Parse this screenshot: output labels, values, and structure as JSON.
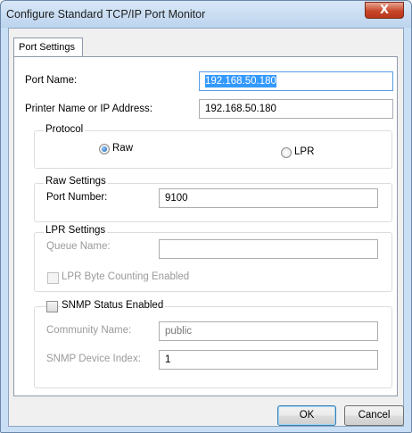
{
  "window": {
    "title": "Configure Standard TCP/IP Port Monitor",
    "close_glyph": "X"
  },
  "tabs": [
    {
      "label": "Port Settings",
      "selected": true
    }
  ],
  "port_settings": {
    "port_name_label": "Port Name:",
    "port_name_value": "192.168.50.180",
    "printer_address_label": "Printer Name or IP Address:",
    "printer_address_value": "192.168.50.180"
  },
  "protocol": {
    "group_label": "Protocol",
    "options": [
      {
        "label": "Raw",
        "selected": true
      },
      {
        "label": "LPR",
        "selected": false
      }
    ]
  },
  "raw_settings": {
    "group_label": "Raw Settings",
    "port_number_label": "Port Number:",
    "port_number_value": "9100"
  },
  "lpr_settings": {
    "group_label": "LPR Settings",
    "queue_name_label": "Queue Name:",
    "queue_name_value": "",
    "byte_counting_label": "LPR Byte Counting Enabled",
    "byte_counting_checked": false
  },
  "snmp": {
    "enabled_label": "SNMP Status Enabled",
    "enabled_checked": false,
    "community_label": "Community Name:",
    "community_value": "public",
    "device_index_label": "SNMP Device Index:",
    "device_index_value": "1"
  },
  "buttons": {
    "ok": "OK",
    "cancel": "Cancel"
  },
  "colors": {
    "title_bar": "#bcd4ee",
    "close_button": "#c7472b",
    "selection": "#3399ff",
    "disabled_text": "#9a9a9a"
  }
}
